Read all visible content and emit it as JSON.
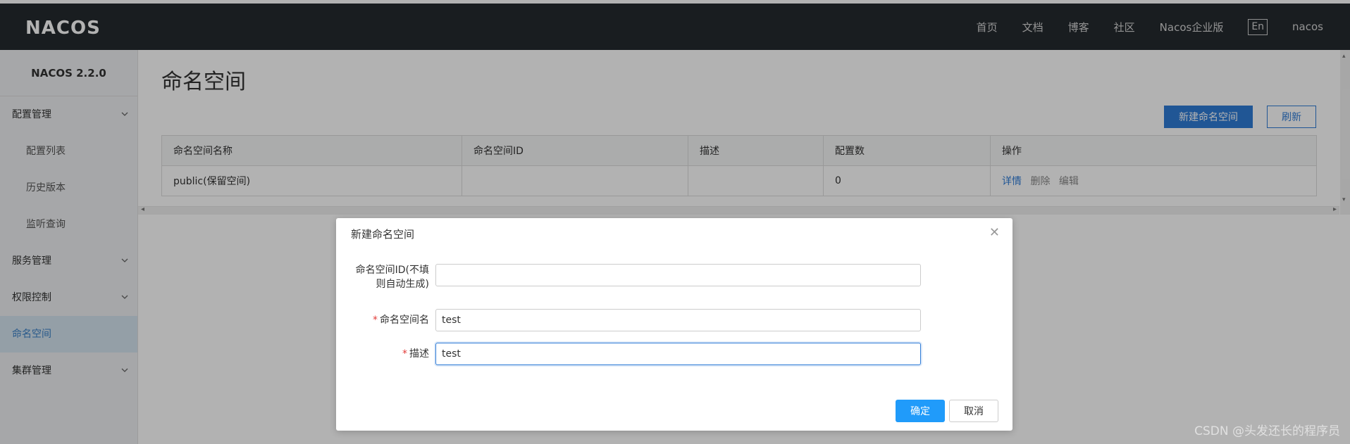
{
  "header": {
    "logo_text": "NACOS",
    "nav": [
      "首页",
      "文档",
      "博客",
      "社区",
      "Nacos企业版"
    ],
    "lang": "En",
    "user": "nacos"
  },
  "sidebar": {
    "version": "NACOS 2.2.0",
    "items": [
      {
        "label": "配置管理",
        "type": "group"
      },
      {
        "label": "配置列表",
        "type": "sub"
      },
      {
        "label": "历史版本",
        "type": "sub"
      },
      {
        "label": "监听查询",
        "type": "sub"
      },
      {
        "label": "服务管理",
        "type": "group"
      },
      {
        "label": "权限控制",
        "type": "group"
      },
      {
        "label": "命名空间",
        "type": "active"
      },
      {
        "label": "集群管理",
        "type": "group"
      }
    ]
  },
  "main": {
    "title": "命名空间",
    "new_button": "新建命名空间",
    "refresh_button": "刷新",
    "table": {
      "columns": [
        "命名空间名称",
        "命名空间ID",
        "描述",
        "配置数",
        "操作"
      ],
      "rows": [
        {
          "name": "public(保留空间)",
          "id": "",
          "desc": "",
          "count": "0",
          "actions": [
            "详情",
            "删除",
            "编辑"
          ]
        }
      ]
    }
  },
  "dialog": {
    "title": "新建命名空间",
    "fields": [
      {
        "label_line1": "命名空间ID(不填",
        "label_line2": "则自动生成)",
        "value": "",
        "required": false
      },
      {
        "label": "命名空间名",
        "value": "test",
        "required": true
      },
      {
        "label": "描述",
        "value": "test",
        "required": true
      }
    ],
    "ok_label": "确定",
    "cancel_label": "取消"
  },
  "watermark": "CSDN @头发还长的程序员"
}
